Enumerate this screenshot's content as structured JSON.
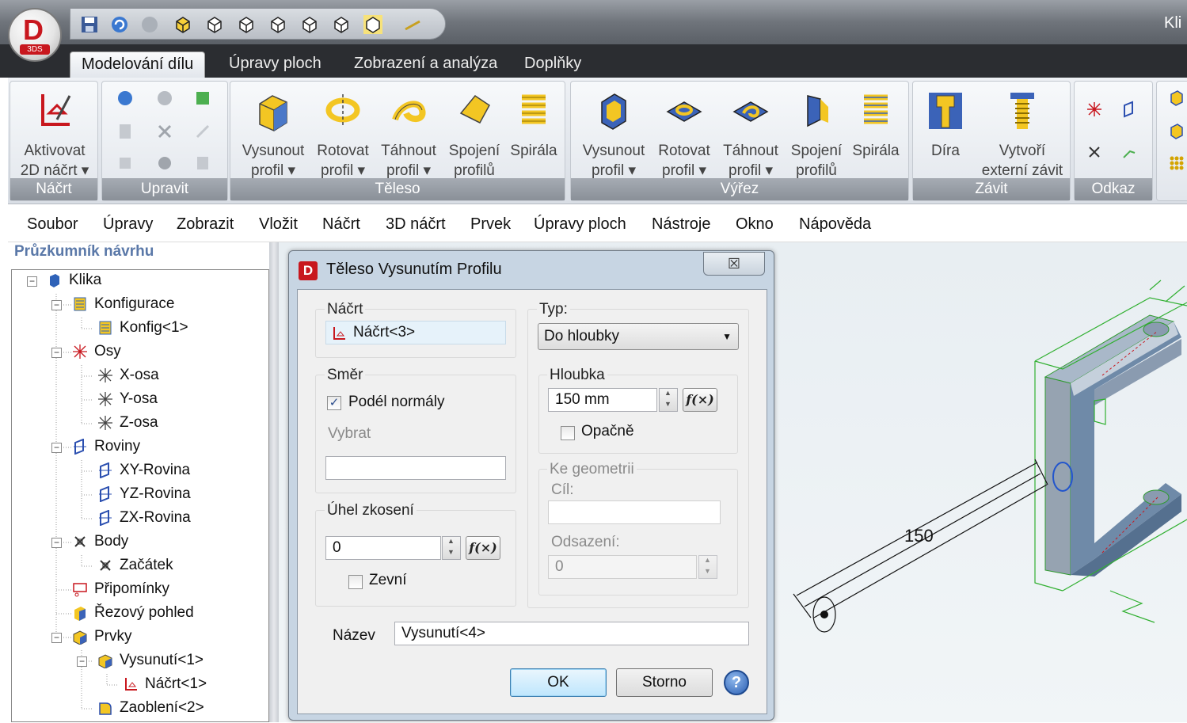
{
  "titlebar": {
    "window_title_fragment": "Kli"
  },
  "app_logo": {
    "letter": "D",
    "sub": "3DS"
  },
  "ribbon": {
    "tabs": [
      "Modelování dílu",
      "Úpravy ploch",
      "Zobrazení a analýza",
      "Doplňky"
    ],
    "active_tab": "Modelování dílu",
    "groups": [
      {
        "title": "Náčrt",
        "buttons": [
          {
            "label1": "Aktivovat",
            "label2": "2D náčrt ▾",
            "icon": "sketch-icon"
          }
        ]
      },
      {
        "title": "Upravit",
        "buttons": []
      },
      {
        "title": "Těleso",
        "buttons": [
          {
            "label1": "Vysunout",
            "label2": "profil ▾",
            "icon": "extrude-icon"
          },
          {
            "label1": "Rotovat",
            "label2": "profil ▾",
            "icon": "revolve-icon"
          },
          {
            "label1": "Táhnout",
            "label2": "profil ▾",
            "icon": "sweep-icon"
          },
          {
            "label1": "Spojení",
            "label2": "profilů",
            "icon": "loft-icon"
          },
          {
            "label1": "Spirála",
            "label2": "",
            "icon": "helix-icon"
          }
        ]
      },
      {
        "title": "Výřez",
        "buttons": [
          {
            "label1": "Vysunout",
            "label2": "profil ▾",
            "icon": "extrude-cut-icon"
          },
          {
            "label1": "Rotovat",
            "label2": "profil ▾",
            "icon": "revolve-cut-icon"
          },
          {
            "label1": "Táhnout",
            "label2": "profil ▾",
            "icon": "sweep-cut-icon"
          },
          {
            "label1": "Spojení",
            "label2": "profilů",
            "icon": "loft-cut-icon"
          },
          {
            "label1": "Spirála",
            "label2": "",
            "icon": "helix-cut-icon"
          }
        ]
      },
      {
        "title": "Závit",
        "buttons": [
          {
            "label1": "Díra",
            "label2": "",
            "icon": "hole-icon"
          },
          {
            "label1": "Vytvoří",
            "label2": "externí závit",
            "icon": "thread-icon"
          }
        ]
      },
      {
        "title": "Odkaz",
        "buttons": []
      }
    ]
  },
  "menubar": [
    "Soubor",
    "Úpravy",
    "Zobrazit",
    "Vložit",
    "Náčrt",
    "3D náčrt",
    "Prvek",
    "Úpravy ploch",
    "Nástroje",
    "Okno",
    "Nápověda"
  ],
  "explorer": {
    "title": "Průzkumník návrhu",
    "tree": [
      {
        "label": "Klika",
        "icon": "part-icon",
        "level": 0
      },
      {
        "label": "Konfigurace",
        "icon": "config-icon",
        "level": 1
      },
      {
        "label": "Konfig<1>",
        "icon": "config-icon",
        "level": 2
      },
      {
        "label": "Osy",
        "icon": "axis-icon",
        "level": 1
      },
      {
        "label": "X-osa",
        "icon": "axis-icon",
        "level": 2
      },
      {
        "label": "Y-osa",
        "icon": "axis-icon",
        "level": 2
      },
      {
        "label": "Z-osa",
        "icon": "axis-icon",
        "level": 2
      },
      {
        "label": "Roviny",
        "icon": "plane-icon",
        "level": 1
      },
      {
        "label": "XY-Rovina",
        "icon": "plane-icon",
        "level": 2
      },
      {
        "label": "YZ-Rovina",
        "icon": "plane-icon",
        "level": 2
      },
      {
        "label": "ZX-Rovina",
        "icon": "plane-icon",
        "level": 2
      },
      {
        "label": "Body",
        "icon": "point-icon",
        "level": 1
      },
      {
        "label": "Začátek",
        "icon": "point-icon",
        "level": 2
      },
      {
        "label": "Připomínky",
        "icon": "annotation-icon",
        "level": 1
      },
      {
        "label": "Řezový pohled",
        "icon": "section-icon",
        "level": 1
      },
      {
        "label": "Prvky",
        "icon": "features-icon",
        "level": 1
      },
      {
        "label": "Vysunutí<1>",
        "icon": "extrude-icon",
        "level": 2
      },
      {
        "label": "Náčrt<1>",
        "icon": "sketch-icon",
        "level": 3
      },
      {
        "label": "Zaoblení<2>",
        "icon": "fillet-icon",
        "level": 2
      }
    ]
  },
  "dialog": {
    "title": "Těleso Vysunutím Profilu",
    "close": "☒",
    "sketch_group": "Náčrt",
    "sketch_value": "Náčrt<3>",
    "direction_group": "Směr",
    "along_normal_label": "Podél normály",
    "along_normal_checked": true,
    "select_label": "Vybrat",
    "select_value": "",
    "draft_group": "Úhel zkosení",
    "draft_value": "0",
    "outward_label": "Zevní",
    "outward_checked": false,
    "type_label": "Typ:",
    "type_value": "Do hloubky",
    "depth_group": "Hloubka",
    "depth_value": "150 mm",
    "reverse_label": "Opačně",
    "reverse_checked": false,
    "to_geometry_group": "Ke geometrii",
    "target_label": "Cíl:",
    "target_value": "",
    "offset_label": "Odsazení:",
    "offset_value": "0",
    "name_label": "Název",
    "name_value": "Vysunutí<4>",
    "fx_label": "f(×)",
    "ok_label": "OK",
    "cancel_label": "Storno",
    "help_label": "?"
  },
  "viewport": {
    "dimension_label": "150"
  }
}
